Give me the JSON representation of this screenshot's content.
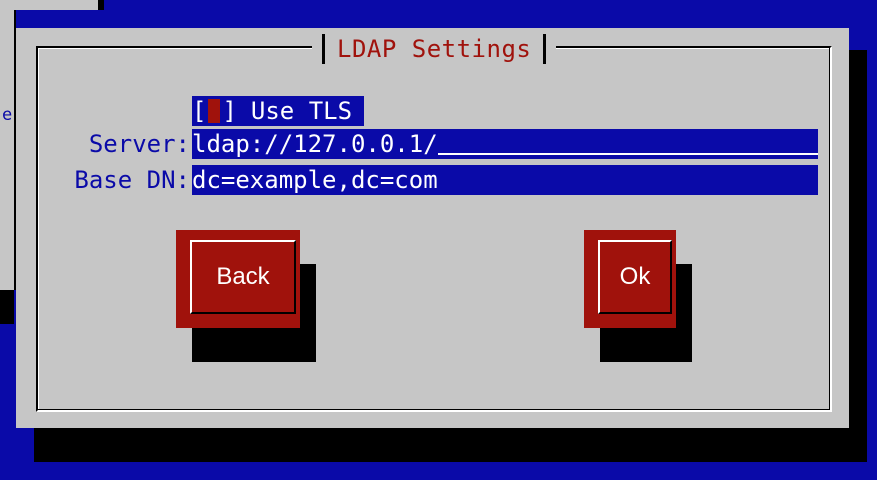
{
  "background": {
    "fragment_label": "e"
  },
  "dialog": {
    "title": "LDAP Settings",
    "use_tls": {
      "checked": false,
      "open_bracket": "[",
      "close_bracket": "]",
      "label": "Use TLS"
    },
    "server": {
      "label": "Server:",
      "value": "ldap://127.0.0.1/"
    },
    "base_dn": {
      "label": "Base DN:",
      "value": "dc=example,dc=com"
    },
    "buttons": {
      "back": "Back",
      "ok": "Ok"
    }
  },
  "colors": {
    "screen_blue": "#0a0aa8",
    "dialog_gray": "#c6c6c6",
    "accent_red": "#a0120c"
  }
}
